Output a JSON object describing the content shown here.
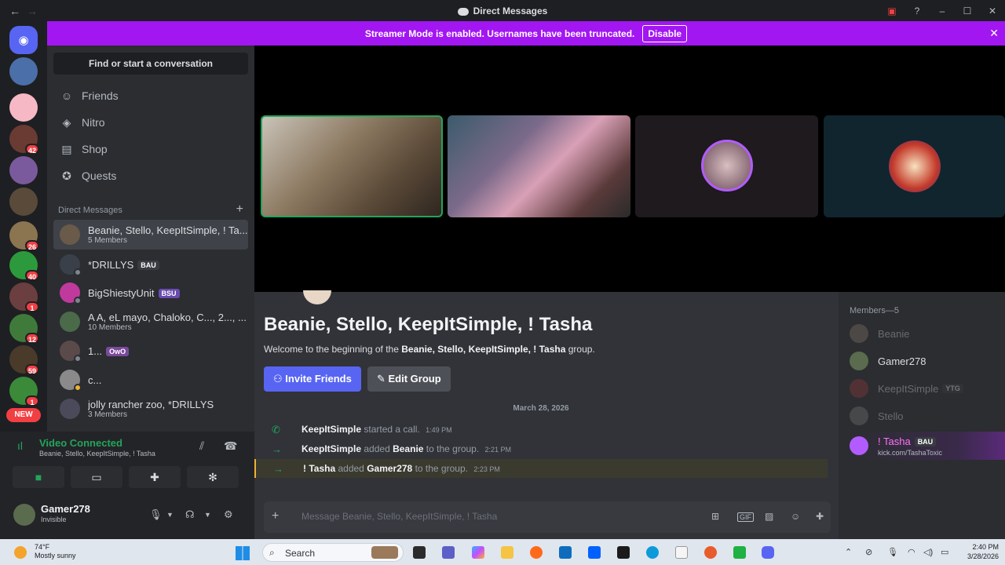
{
  "window": {
    "title": "Direct Messages",
    "back_icon": "←",
    "forward_icon": "→"
  },
  "banner": {
    "text": "Streamer Mode is enabled. Usernames have been truncated.",
    "button": "Disable"
  },
  "rail": {
    "badges": [
      "42",
      "26",
      "40",
      "1",
      "12",
      "59",
      "1"
    ],
    "new_label": "NEW"
  },
  "sidebar": {
    "search_label": "Find or start a conversation",
    "nav": [
      {
        "label": "Friends",
        "icon": "friends-icon"
      },
      {
        "label": "Nitro",
        "icon": "nitro-icon"
      },
      {
        "label": "Shop",
        "icon": "shop-icon"
      },
      {
        "label": "Quests",
        "icon": "quests-icon"
      }
    ],
    "dm_header": "Direct Messages",
    "dms": [
      {
        "name": "Beanie, Stello, KeepItSimple, ! Ta...",
        "sub": "5 Members",
        "selected": true
      },
      {
        "name": "*DRILLYS",
        "tag": "BAU"
      },
      {
        "name": "BigShiestyUnit",
        "tag": "BSU"
      },
      {
        "name": "A A, eL mayo, Chaloko, C..., 2..., ...",
        "sub": "10 Members"
      },
      {
        "name": "1...",
        "tag": "OwO"
      },
      {
        "name": "c..."
      },
      {
        "name": "jolly rancher zoo, *DRILLYS",
        "sub": "3 Members"
      }
    ]
  },
  "voice": {
    "status": "Video Connected",
    "channel": "Beanie, Stello, KeepItSimple, ! Tasha"
  },
  "user": {
    "name": "Gamer278",
    "status": "Invisible"
  },
  "chat": {
    "title": "Beanie, Stello, KeepItSimple, ! Tasha",
    "welcome_prefix": "Welcome to the beginning of the ",
    "welcome_group": "Beanie, Stello, KeepItSimple, ! Tasha",
    "welcome_suffix": " group.",
    "invite_label": "Invite Friends",
    "edit_label": "Edit Group",
    "date": "March 28, 2026",
    "messages": [
      {
        "actor": "KeepItSimple",
        "text": "started a call.",
        "target": "",
        "text2": "",
        "time": "1:49 PM"
      },
      {
        "actor": "KeepItSimple",
        "text": "added",
        "target": "Beanie",
        "text2": "to the group.",
        "time": "2:21 PM"
      },
      {
        "actor": "! Tasha",
        "text": "added",
        "target": "Gamer278",
        "text2": "to the group.",
        "time": "2:23 PM"
      }
    ],
    "composer_placeholder": "Message Beanie, Stello, KeepItSimple, ! Tasha"
  },
  "members": {
    "header": "Members—5",
    "list": [
      {
        "name": "Beanie",
        "offline": true
      },
      {
        "name": "Gamer278",
        "offline": false
      },
      {
        "name": "KeepItSimple",
        "tag": "YTG",
        "offline": true
      },
      {
        "name": "Stello",
        "offline": true
      },
      {
        "name": "! Tasha",
        "tag": "BAU",
        "sub": "kick.com/TashaToxic",
        "offline": false
      }
    ]
  },
  "taskbar": {
    "temp": "74°F",
    "weather": "Mostly sunny",
    "search": "Search",
    "time": "2:40 PM",
    "date": "3/28/2026"
  }
}
